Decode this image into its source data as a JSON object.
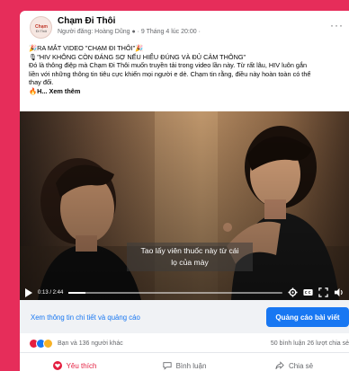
{
  "post": {
    "page_name": "Chạm Đi Thôi",
    "meta": "Người đăng: Hoàng Dũng ● · 9 Tháng 4 lúc 20:00 ·",
    "more": "···",
    "text_lines": [
      "🎉RA MẮT VIDEO \"CHẠM ĐI THÔI\"🎉",
      "🎙\"HIV KHÔNG CÒN ĐÁNG SỢ NẾU HIỂU ĐÚNG VÀ ĐỦ CẢM THÔNG\"",
      "Đó là thông điệp mà Chạm Đi Thôi muốn truyền tải trong video lần này. Từ rất lâu, HIV luôn gắn",
      "liền với những thông tin tiêu cực khiến mọi người e dè. Chạm tin rằng, điều này hoàn toàn có thể",
      "thay đổi."
    ],
    "see_more": "🔥H... Xem thêm"
  },
  "video": {
    "caption_line1": "Tao lấy viên thuốc này từ cái",
    "caption_line2": "lọ của mày",
    "time": "0:13 / 2:44",
    "progress_fraction": 0.08
  },
  "cta": {
    "details_link": "Xem thông tin chi tiết và quảng cáo",
    "boost_button": "Quảng cáo bài viết"
  },
  "engagement": {
    "reactions_text": "Bạn và 136 người khác",
    "stats": "50 bình luận  26 lượt chia sẻ"
  },
  "actions": {
    "like": "Yêu thích",
    "comment": "Bình luận",
    "share": "Chia sẻ"
  },
  "colors": {
    "background": "#e62d5a",
    "link_blue": "#1877f2",
    "love_red": "#e41e3f"
  }
}
